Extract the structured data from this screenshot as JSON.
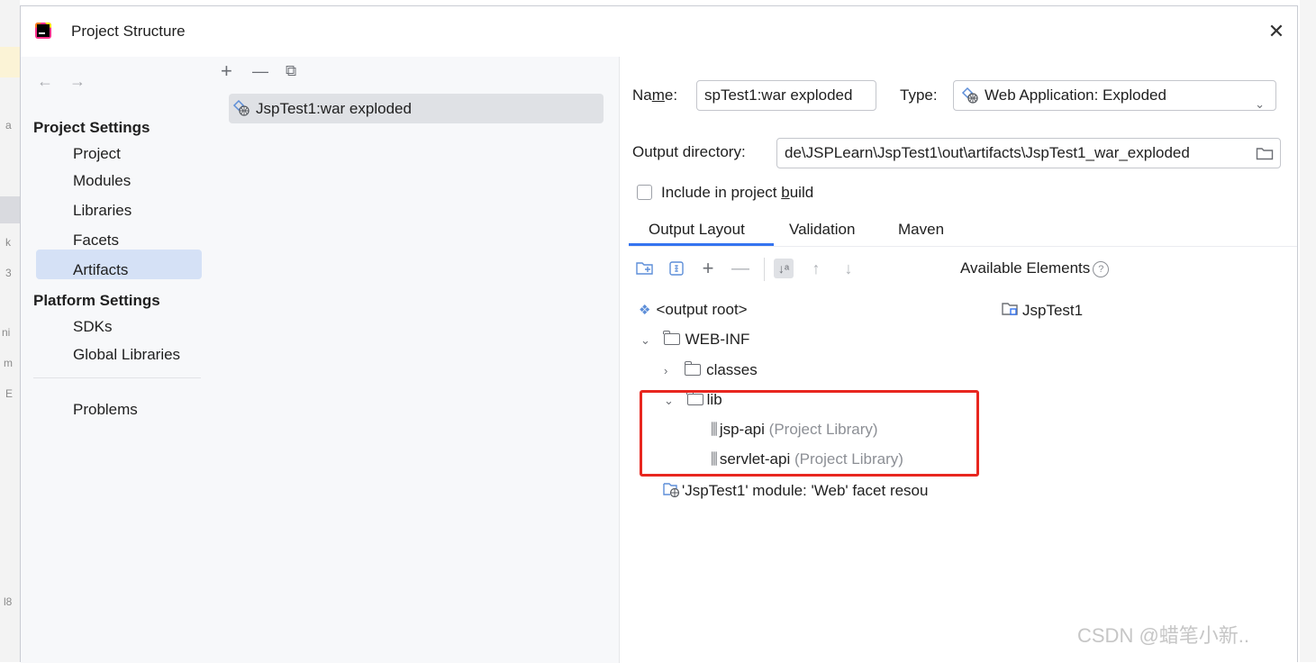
{
  "window": {
    "title": "Project Structure",
    "close_glyph": "✕"
  },
  "nav": {
    "back_glyph": "←",
    "forward_glyph": "→",
    "project_settings_header": "Project Settings",
    "project_settings_items": [
      "Project",
      "Modules",
      "Libraries",
      "Facets",
      "Artifacts"
    ],
    "selected_item": "Artifacts",
    "platform_settings_header": "Platform Settings",
    "platform_settings_items": [
      "SDKs",
      "Global Libraries"
    ],
    "problems": "Problems"
  },
  "artifacts": {
    "toolbar": {
      "add": "+",
      "remove": "—",
      "copy": "⧉"
    },
    "items": [
      "JspTest1:war exploded"
    ]
  },
  "detail": {
    "name_label_pre": "Na",
    "name_label_mnemonic": "m",
    "name_label_post": "e:",
    "name_value": "spTest1:war exploded",
    "type_label": "Type:",
    "type_value": "Web Application: Exploded",
    "output_dir_label": "Output directory:",
    "output_dir_value": "de\\JSPLearn\\JspTest1\\out\\artifacts\\JspTest1_war_exploded",
    "include_build_pre": "Include in project ",
    "include_build_mnemonic": "b",
    "include_build_post": "uild",
    "include_build_checked": false,
    "tabs": [
      "Output Layout",
      "Validation",
      "Maven"
    ],
    "active_tab": "Output Layout",
    "available_elements": "Available Elements",
    "help_glyph": "?"
  },
  "layout_tree": {
    "output_root": "<output root>",
    "web_inf": "WEB-INF",
    "classes": "classes",
    "lib": "lib",
    "libraries": [
      {
        "name": "jsp-api",
        "kind": "(Project Library)"
      },
      {
        "name": "servlet-api",
        "kind": "(Project Library)"
      }
    ],
    "facet_resources": "'JspTest1' module: 'Web' facet resou"
  },
  "available_tree": {
    "items": [
      "JspTest1"
    ]
  },
  "background": {
    "fragments": [
      "a",
      "k",
      "3",
      "ni",
      "m",
      "E",
      "l8"
    ]
  },
  "watermark": "CSDN @蜡笔小新..",
  "colors": {
    "accent": "#3574f0",
    "selection": "#d5e1f6",
    "highlight_box": "#e8261f"
  }
}
